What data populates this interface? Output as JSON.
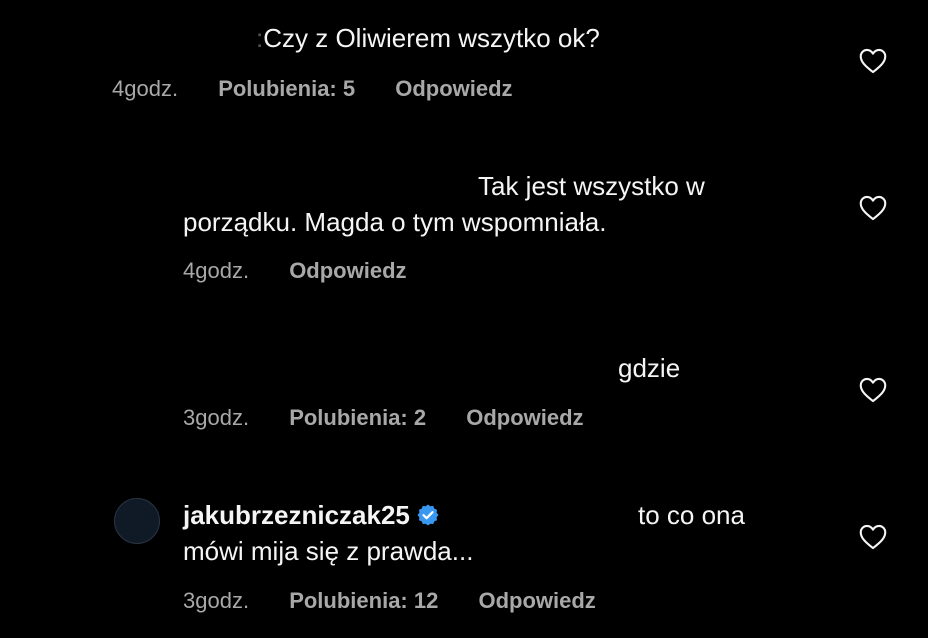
{
  "colors": {
    "background": "#000000",
    "text": "#f5f5f5",
    "meta": "#a8a8a8",
    "verified": "#3897f0"
  },
  "comments": [
    {
      "text_lines": [
        "Czy z Oliwierem wszytko ok?"
      ],
      "time": "4godz.",
      "likes": "Polubienia: 5",
      "reply": "Odpowiedz",
      "icon": "heart-icon"
    },
    {
      "text_lines": [
        "Tak jest wszystko w",
        "porządku. Magda o tym wspomniała."
      ],
      "time": "4godz.",
      "reply": "Odpowiedz",
      "icon": "heart-icon"
    },
    {
      "text_lines": [
        "gdzie"
      ],
      "time": "3godz.",
      "likes": "Polubienia: 2",
      "reply": "Odpowiedz",
      "icon": "heart-icon"
    },
    {
      "username": "jakubrzezniczak25",
      "text_lines": [
        "to co ona",
        "mówi mija się z prawda..."
      ],
      "time": "3godz.",
      "likes": "Polubienia: 12",
      "reply": "Odpowiedz",
      "icon": "heart-icon",
      "verified_icon": "verified-badge-icon"
    }
  ]
}
